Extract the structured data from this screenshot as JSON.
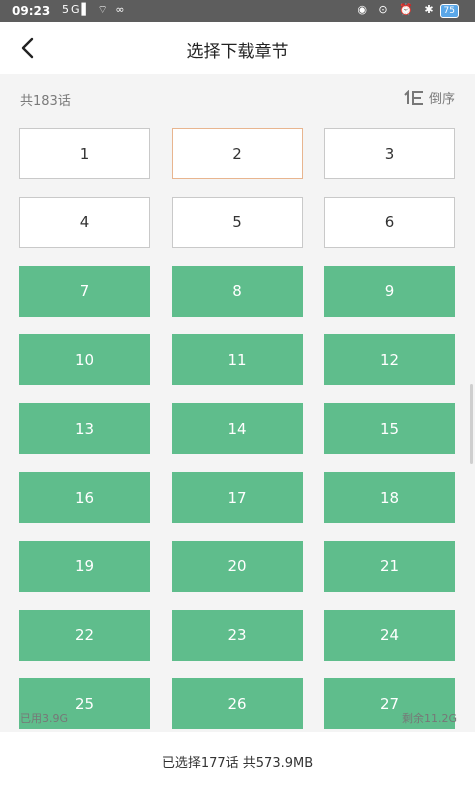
{
  "status_bar": {
    "time": "09:23",
    "signal_text": "5G▌ ⌔ ∞",
    "right_text": "◉ ⊙ ⏰ ✱",
    "battery": "75"
  },
  "header": {
    "title": "选择下载章节"
  },
  "list": {
    "total": "共183话",
    "sort_label": "倒序"
  },
  "chapters": [
    {
      "label": "1",
      "state": "empty"
    },
    {
      "label": "2",
      "state": "focused"
    },
    {
      "label": "3",
      "state": "empty"
    },
    {
      "label": "4",
      "state": "empty"
    },
    {
      "label": "5",
      "state": "empty"
    },
    {
      "label": "6",
      "state": "empty"
    },
    {
      "label": "7",
      "state": "selected"
    },
    {
      "label": "8",
      "state": "selected"
    },
    {
      "label": "9",
      "state": "selected"
    },
    {
      "label": "10",
      "state": "selected"
    },
    {
      "label": "11",
      "state": "selected"
    },
    {
      "label": "12",
      "state": "selected"
    },
    {
      "label": "13",
      "state": "selected"
    },
    {
      "label": "14",
      "state": "selected"
    },
    {
      "label": "15",
      "state": "selected"
    },
    {
      "label": "16",
      "state": "selected"
    },
    {
      "label": "17",
      "state": "selected"
    },
    {
      "label": "18",
      "state": "selected"
    },
    {
      "label": "19",
      "state": "selected"
    },
    {
      "label": "20",
      "state": "selected"
    },
    {
      "label": "21",
      "state": "selected"
    },
    {
      "label": "22",
      "state": "selected"
    },
    {
      "label": "23",
      "state": "selected"
    },
    {
      "label": "24",
      "state": "selected"
    },
    {
      "label": "25",
      "state": "selected"
    },
    {
      "label": "26",
      "state": "selected"
    },
    {
      "label": "27",
      "state": "selected"
    }
  ],
  "storage": {
    "used": "已用3.9G",
    "free": "剩余11.2G"
  },
  "footer": {
    "summary": "已选择177话 共573.9MB"
  },
  "colors": {
    "selected_green": "#5fbd8c",
    "focus_border": "#e8b58f"
  }
}
